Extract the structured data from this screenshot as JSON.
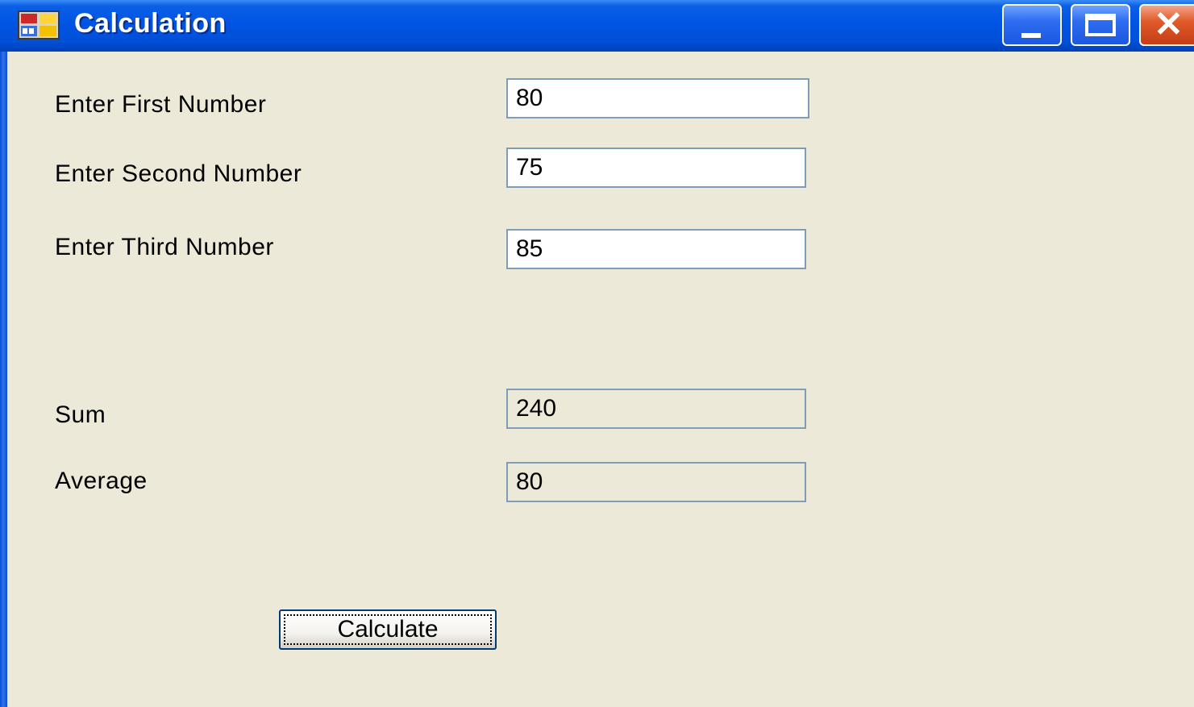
{
  "window": {
    "title": "Calculation",
    "title_icon": "app-form-icon",
    "controls": [
      "minimize-icon",
      "maximize-icon",
      "close-icon"
    ]
  },
  "form": {
    "first_label": "Enter First Number",
    "first_value": "80",
    "second_label": "Enter Second Number",
    "second_value": "75",
    "third_label": "Enter Third Number",
    "third_value": "85",
    "sum_label": "Sum",
    "sum_value": "240",
    "average_label": "Average",
    "average_value": "80",
    "calculate_label": "Calculate"
  },
  "colors": {
    "titlebar": "#0054e3",
    "background": "#ece9d8",
    "field_border": "#7f9db9"
  }
}
